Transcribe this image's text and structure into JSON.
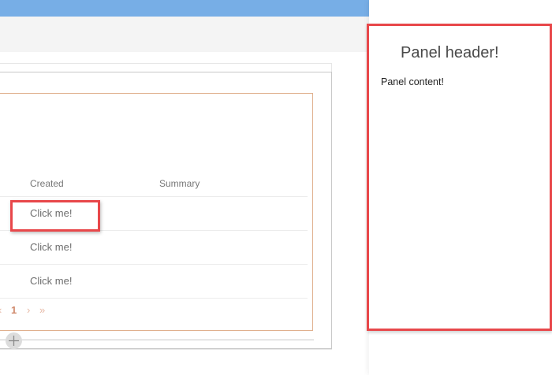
{
  "list": {
    "columns": {
      "created": "Created",
      "summary": "Summary"
    },
    "rows": [
      {
        "link_label": "Click me!"
      },
      {
        "link_label": "Click me!"
      },
      {
        "link_label": "Click me!"
      }
    ],
    "pagination": {
      "prev_icon": "‹",
      "current_page": "1",
      "next_icon": "›",
      "last_icon": "»"
    }
  },
  "panel": {
    "header": "Panel header!",
    "content": "Panel content!"
  },
  "colors": {
    "topbar": "#77aee6",
    "highlight": "#e8474a",
    "accent": "#d08a6d"
  },
  "icons": {
    "add": "plus-icon"
  }
}
